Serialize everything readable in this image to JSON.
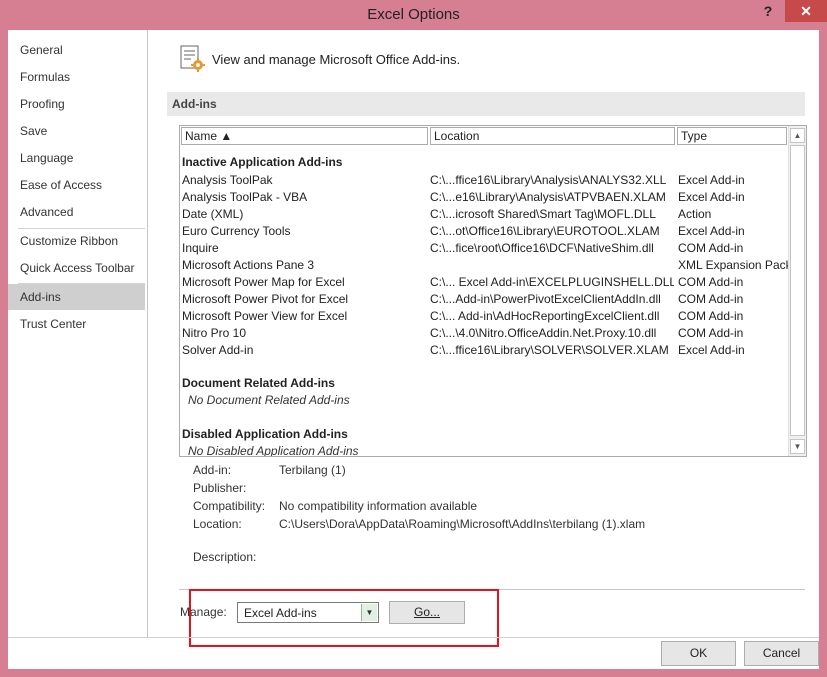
{
  "window": {
    "title": "Excel Options",
    "help_label": "?",
    "close_label": "✕"
  },
  "sidebar": {
    "items": [
      {
        "label": "General"
      },
      {
        "label": "Formulas"
      },
      {
        "label": "Proofing"
      },
      {
        "label": "Save"
      },
      {
        "label": "Language"
      },
      {
        "label": "Ease of Access"
      },
      {
        "label": "Advanced"
      },
      {
        "label": "Customize Ribbon"
      },
      {
        "label": "Quick Access Toolbar"
      },
      {
        "label": "Add-ins",
        "selected": true
      },
      {
        "label": "Trust Center"
      }
    ]
  },
  "main": {
    "heading": "View and manage Microsoft Office Add-ins.",
    "heading_icon": "addins-gear-icon",
    "section_title": "Add-ins"
  },
  "list": {
    "columns": {
      "name": "Name ▲",
      "location": "Location",
      "type": "Type"
    },
    "groups": {
      "inactive": {
        "title": "Inactive Application Add-ins",
        "rows": [
          {
            "name": "Analysis ToolPak",
            "location": "C:\\...ffice16\\Library\\Analysis\\ANALYS32.XLL",
            "type": "Excel Add-in"
          },
          {
            "name": "Analysis ToolPak - VBA",
            "location": "C:\\...e16\\Library\\Analysis\\ATPVBAEN.XLAM",
            "type": "Excel Add-in"
          },
          {
            "name": "Date (XML)",
            "location": "C:\\...icrosoft Shared\\Smart Tag\\MOFL.DLL",
            "type": "Action"
          },
          {
            "name": "Euro Currency Tools",
            "location": "C:\\...ot\\Office16\\Library\\EUROTOOL.XLAM",
            "type": "Excel Add-in"
          },
          {
            "name": "Inquire",
            "location": "C:\\...fice\\root\\Office16\\DCF\\NativeShim.dll",
            "type": "COM Add-in"
          },
          {
            "name": "Microsoft Actions Pane 3",
            "location": "",
            "type": "XML Expansion Pack"
          },
          {
            "name": "Microsoft Power Map for Excel",
            "location": "C:\\... Excel Add-in\\EXCELPLUGINSHELL.DLL",
            "type": "COM Add-in"
          },
          {
            "name": "Microsoft Power Pivot for Excel",
            "location": "C:\\...Add-in\\PowerPivotExcelClientAddIn.dll",
            "type": "COM Add-in"
          },
          {
            "name": "Microsoft Power View for Excel",
            "location": "C:\\... Add-in\\AdHocReportingExcelClient.dll",
            "type": "COM Add-in"
          },
          {
            "name": "Nitro Pro 10",
            "location": "C:\\...\\4.0\\Nitro.OfficeAddin.Net.Proxy.10.dll",
            "type": "COM Add-in"
          },
          {
            "name": "Solver Add-in",
            "location": "C:\\...ffice16\\Library\\SOLVER\\SOLVER.XLAM",
            "type": "Excel Add-in"
          }
        ]
      },
      "document": {
        "title": "Document Related Add-ins",
        "empty": "No Document Related Add-ins"
      },
      "disabled": {
        "title": "Disabled Application Add-ins",
        "empty": "No Disabled Application Add-ins"
      }
    }
  },
  "details": {
    "addin_label": "Add-in:",
    "addin_value": "Terbilang (1)",
    "publisher_label": "Publisher:",
    "publisher_value": "",
    "compat_label": "Compatibility:",
    "compat_value": "No compatibility information available",
    "location_label": "Location:",
    "location_value": "C:\\Users\\Dora\\AppData\\Roaming\\Microsoft\\AddIns\\terbilang (1).xlam",
    "description_label": "Description:",
    "description_value": ""
  },
  "manage": {
    "label": "Manage:",
    "selected": "Excel Add-ins",
    "go_label": "Go..."
  },
  "footer": {
    "ok_label": "OK",
    "cancel_label": "Cancel"
  },
  "colors": {
    "titlebar": "#d67e92",
    "close": "#c74a4a",
    "highlight": "#e3131c",
    "selected_nav": "#cfcfcf"
  }
}
